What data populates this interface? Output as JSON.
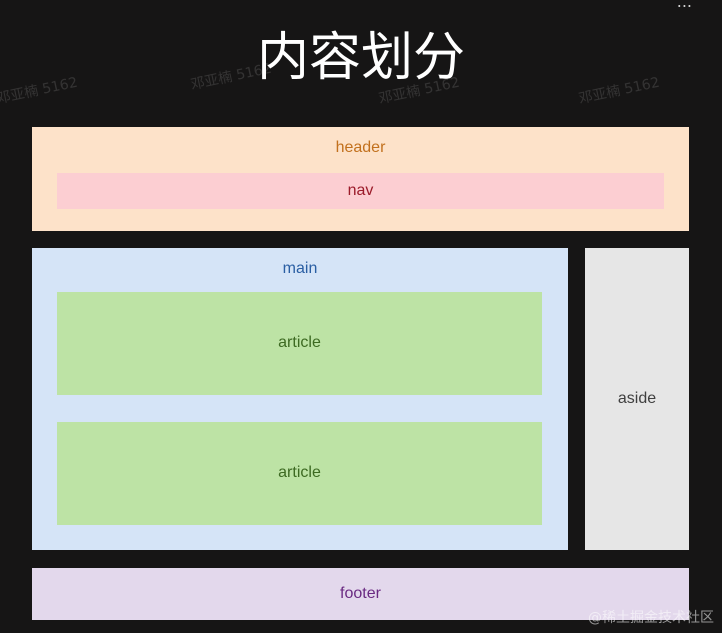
{
  "title": "内容划分",
  "watermark": "邓亚楠 5162",
  "top_mark": "...",
  "corner_mark": "@稀土掘金技术社区",
  "layout": {
    "header": "header",
    "nav": "nav",
    "main": "main",
    "article_1": "article",
    "article_2": "article",
    "aside": "aside",
    "footer": "footer"
  },
  "colors": {
    "background": "#161515",
    "header": "#fde2c9",
    "nav": "#fcced2",
    "main": "#d5e4f7",
    "article": "#bde3a5",
    "aside": "#e6e6e6",
    "footer": "#e3d8ec"
  }
}
